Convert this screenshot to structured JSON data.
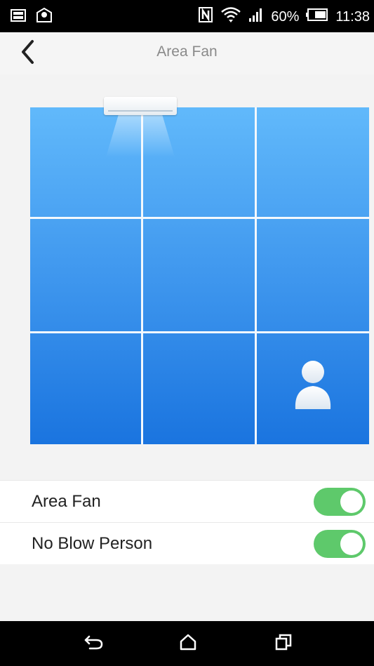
{
  "status_bar": {
    "battery_percent": "60%",
    "time": "11:38",
    "icons": [
      "image-notification-icon",
      "mail-notification-icon",
      "nfc-icon",
      "wifi-icon",
      "signal-icon",
      "battery-icon"
    ]
  },
  "header": {
    "title": "Area Fan",
    "back_icon": "chevron-left-icon"
  },
  "room": {
    "grid_rows": 3,
    "grid_cols": 3,
    "gradient_top": "#61b9fb",
    "gradient_bottom": "#1a74df",
    "ac_unit_icon": "air-conditioner-icon",
    "person_icon": "person-icon",
    "person_cell": {
      "row": 3,
      "col": 3
    }
  },
  "settings": [
    {
      "label": "Area Fan",
      "enabled": true
    },
    {
      "label": "No Blow Person",
      "enabled": true
    }
  ],
  "colors": {
    "toggle_on": "#5ec96b",
    "header_title": "#8a8a8a"
  },
  "nav_bar": {
    "icons": [
      "back-nav-icon",
      "home-nav-icon",
      "recents-nav-icon"
    ]
  }
}
